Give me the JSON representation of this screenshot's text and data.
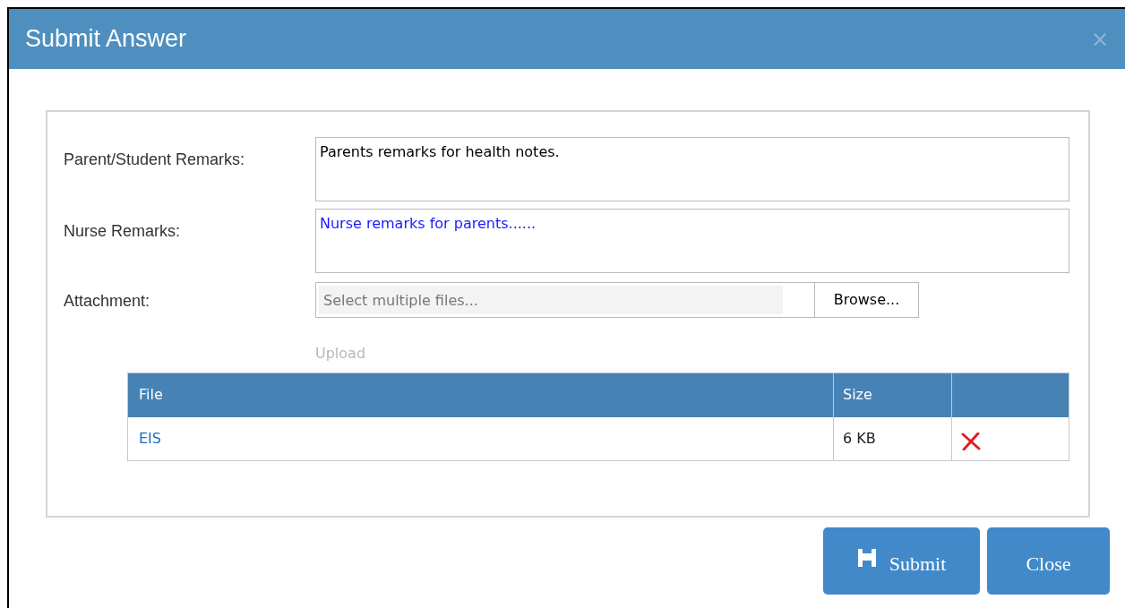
{
  "window": {
    "title": "Submit Answer",
    "close": "×"
  },
  "fields": [
    {
      "label": "Parent/Student Remarks:",
      "value": "Parents remarks for health notes.",
      "color": "#000000"
    },
    {
      "label": "Nurse Remarks:",
      "value": "Nurse remarks for parents......",
      "color": "#1a1aff"
    }
  ],
  "attachment": {
    "label": "Attachment:",
    "placeholder": "Select multiple files...",
    "browse": "Browse..."
  },
  "upload": {
    "label": "Upload",
    "disabled": true
  },
  "table": {
    "columns": [
      "File",
      "Size"
    ],
    "rows": [
      {
        "file": "EIS",
        "size": "6 KB"
      }
    ]
  },
  "buttons": [
    {
      "label": "Submit",
      "kind": "save"
    },
    {
      "label": "Close",
      "kind": "plain"
    }
  ]
}
